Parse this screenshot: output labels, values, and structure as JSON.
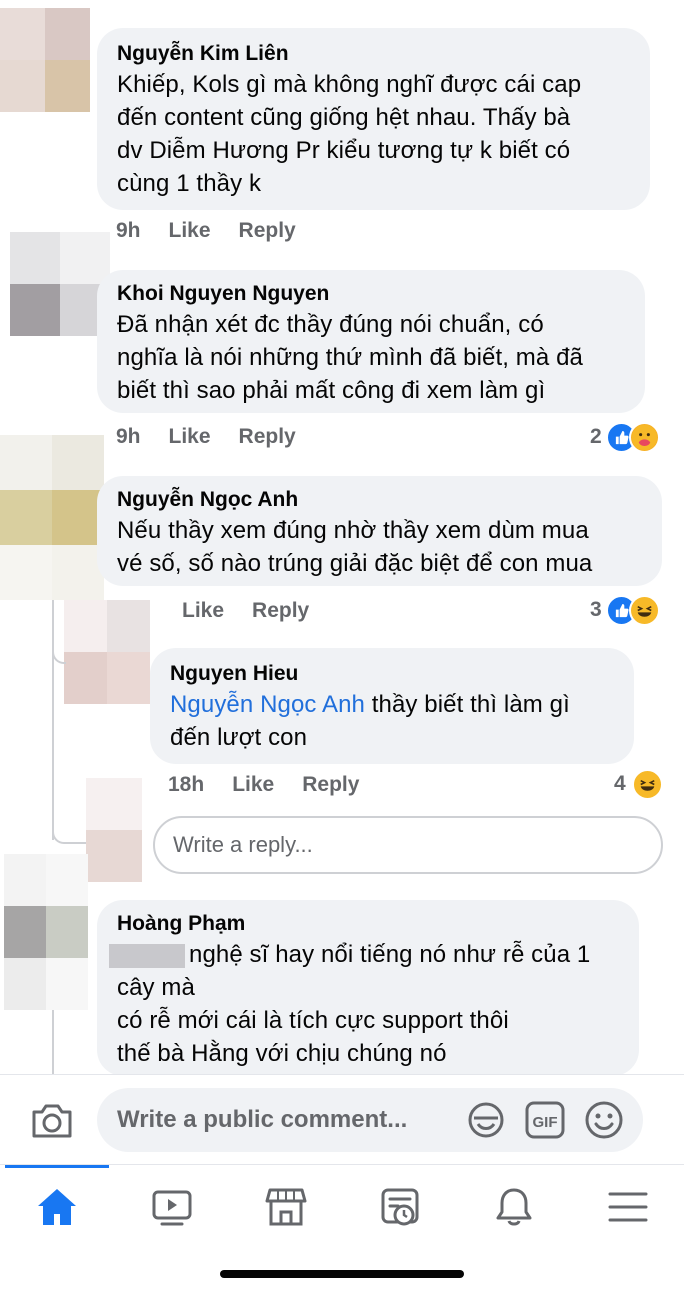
{
  "comments": [
    {
      "author": "Nguyễn Kim Liên",
      "text": "Khiếp, Kols gì mà không nghĩ được cái cap đến content cũng giống hệt nhau.  Thấy bà dv Diễm Hương Pr kiểu tương tự k biết có cùng 1 thầy k",
      "lines": [
        "Khiếp, Kols gì mà không nghĩ được cái cap",
        "đến content cũng giống hệt nhau.  Thấy bà",
        "dv Diễm Hương Pr kiểu tương tự k biết có",
        "cùng 1 thầy k"
      ],
      "time": "9h",
      "like": "Like",
      "reply": "Reply"
    },
    {
      "author": "Khoi Nguyen Nguyen",
      "lines": [
        "Đã nhận xét đc thầy đúng nói chuẩn, có",
        "nghĩa là nói những thứ mình đã biết, mà đã",
        "biết thì sao phải mất công đi xem làm gì"
      ],
      "time": "9h",
      "like": "Like",
      "reply": "Reply",
      "reaction_count": "2",
      "reactions": [
        "like-icon",
        "care-icon"
      ]
    },
    {
      "author": "Nguyễn Ngọc Anh",
      "lines": [
        "Nếu thầy xem đúng nhờ thầy xem dùm mua",
        "vé số, số nào trúng giải đặc biệt để con mua"
      ],
      "time": "",
      "like": "Like",
      "reply": "Reply",
      "reaction_count": "3",
      "reactions": [
        "like-icon",
        "haha-icon"
      ],
      "reply_item": {
        "author": "Nguyen Hieu",
        "mention": "Nguyễn Ngọc Anh",
        "line1_rest": " thầy biết thì làm gì",
        "line2": "đến lượt con",
        "time": "18h",
        "like": "Like",
        "reply": "Reply",
        "reaction_count": "4",
        "reactions": [
          "haha-icon"
        ]
      },
      "write_reply_placeholder": "Write a reply..."
    },
    {
      "author": "Hoàng Phạm",
      "lines": [
        "nghệ sĩ hay nổi tiếng nó như rễ của 1",
        "cây mà",
        "có rễ mới cái là tích cực support thôi",
        "thế bà Hằng với chịu chúng nó"
      ]
    }
  ],
  "composer": {
    "placeholder": "Write a public comment..."
  },
  "composer_icons": [
    "camera-icon",
    "sticker-icon",
    "gif-icon",
    "emoji-icon"
  ],
  "tabs": [
    "home-icon",
    "video-icon",
    "marketplace-icon",
    "news-icon",
    "notifications-icon",
    "menu-icon"
  ],
  "colors": {
    "accent": "#1877f2",
    "bubble": "#f0f2f5",
    "meta": "#65676b",
    "mention": "#216fdb"
  }
}
